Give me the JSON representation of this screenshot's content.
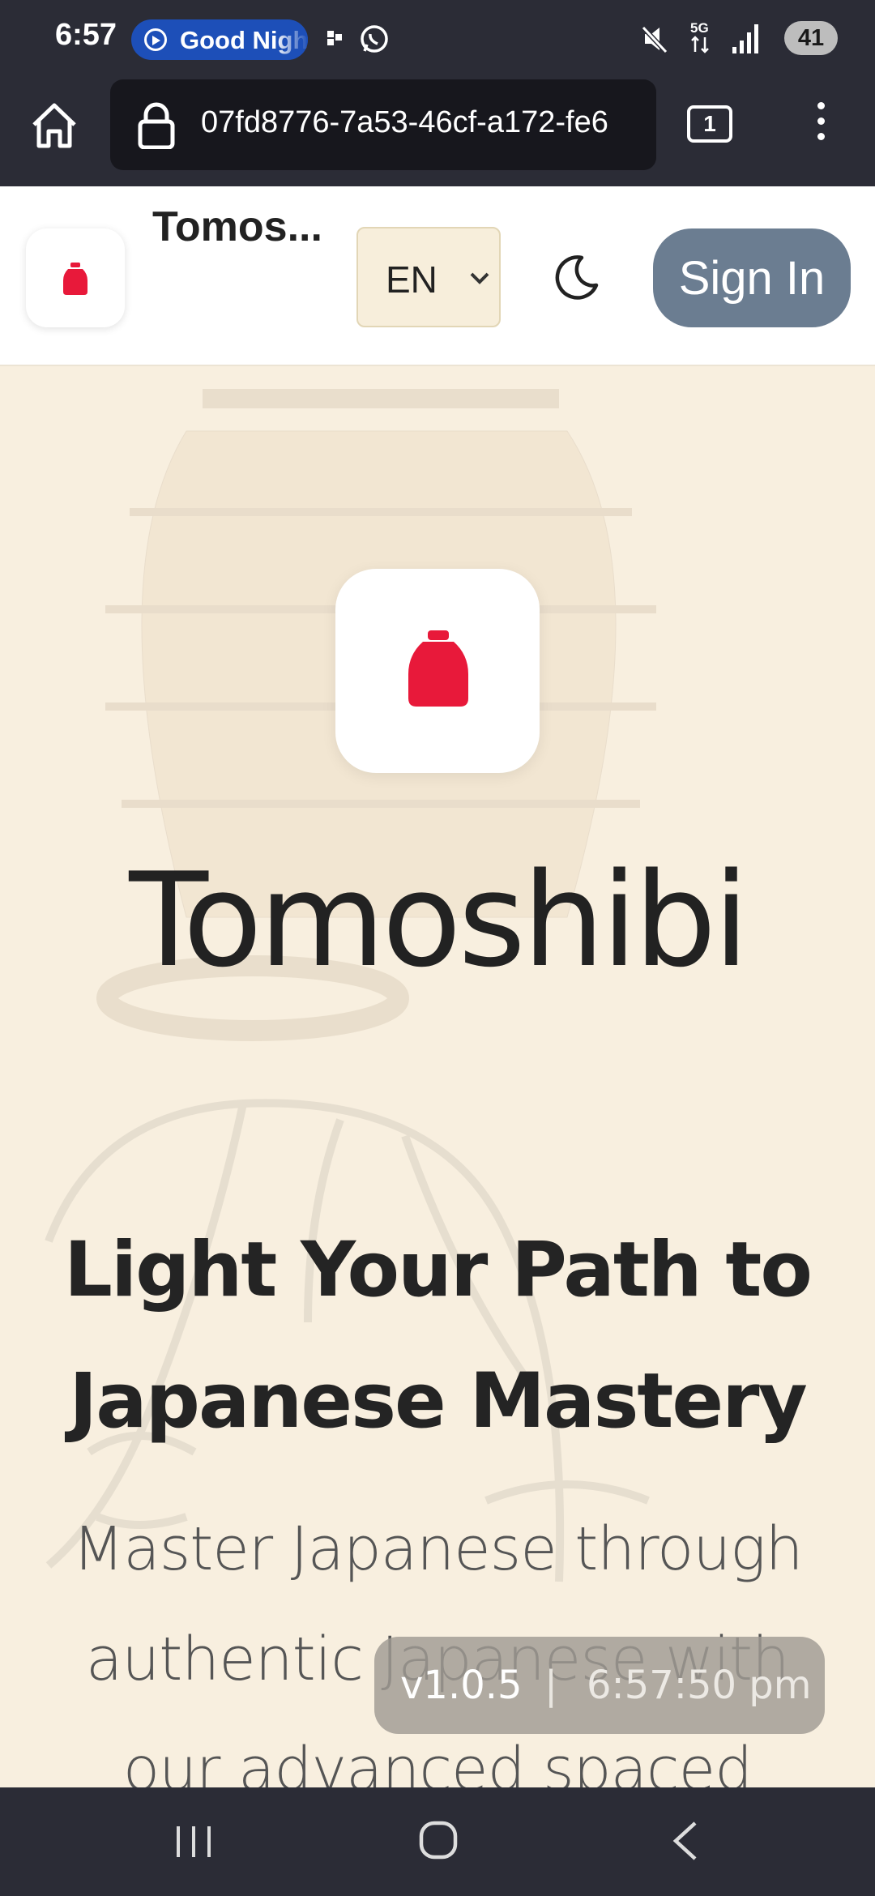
{
  "status_bar": {
    "time": "6:57",
    "notification_pill": "Good Night",
    "battery": "41",
    "network": "5G"
  },
  "browser": {
    "url": "07fd8776-7a53-46cf-a172-fe6",
    "tab_count": "1"
  },
  "header": {
    "brand": "Tomos...",
    "language": "EN",
    "sign_in": "Sign In"
  },
  "hero": {
    "title": "Tomoshibi",
    "tagline": "Light Your Path to Japanese Mastery",
    "description": "Master Japanese through authentic Japanese with our advanced spaced"
  },
  "toast": {
    "version": "v1.0.5",
    "separator": "|",
    "time": "6:57:50 pm"
  },
  "colors": {
    "accent_red": "#e8193a",
    "sign_in_bg": "#6b7d91",
    "page_bg": "#f8efdf"
  }
}
